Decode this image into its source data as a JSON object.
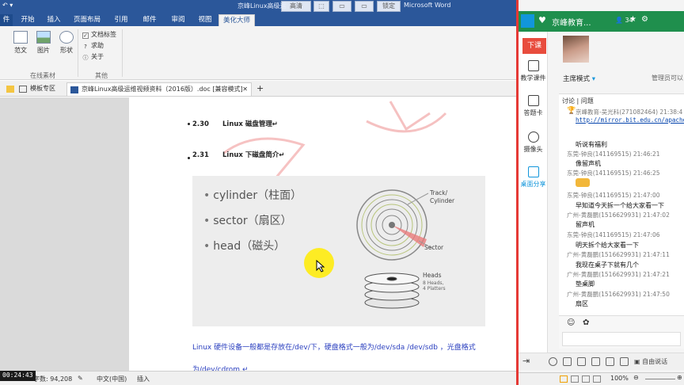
{
  "window": {
    "title": "京峰Linux高级运",
    "app_name": "Microsoft Word",
    "overlay_buttons": [
      "高清",
      "",
      "",
      "",
      "全屏",
      "",
      "锁定"
    ]
  },
  "ribbon_tabs": [
    "开始",
    "插入",
    "页面布局",
    "引用",
    "邮件",
    "审阅",
    "视图",
    "美化大师"
  ],
  "ribbon_buttons": [
    "范文",
    "图片",
    "形状"
  ],
  "ribbon_checks": [
    {
      "label": "文档标签",
      "checked": true
    },
    {
      "label": "求助",
      "checked": false
    },
    {
      "label": "关于",
      "checked": false
    }
  ],
  "ribbon_groups": [
    "在线素材",
    "其他"
  ],
  "doc_tabs": [
    {
      "label": "模板专区",
      "active": false
    },
    {
      "label": "京峰Linux高级运维视频资料（2016版）.doc [兼容模式]",
      "active": true
    }
  ],
  "doc_tabs_add": "+",
  "headings": [
    {
      "num": "2.30",
      "text": "Linux 磁盘管理↵"
    },
    {
      "num": "2.31",
      "text": "Linux 下磁盘简介↵"
    }
  ],
  "slide": {
    "items": [
      "cylinder（柱面）",
      "sector（扇区）",
      "head（磁头）"
    ],
    "disk_labels": {
      "track": "Track/",
      "cylinder": "Cylinder",
      "sector": "Sector",
      "heads": "Heads",
      "heads_sub1": "8 Heads,",
      "heads_sub2": "4 Platters"
    }
  },
  "body_text": [
    "Linux 硬件设备一般都是存放在/dev/下，硬盘格式一般为/dev/sda /dev/sdb ，光盘格式",
    "为/dev/cdrom ↵"
  ],
  "statusbar": {
    "timer": "00:24:43",
    "word_count": "字数: 94,208",
    "language": "中文(中国)",
    "mode": "插入"
  },
  "panel": {
    "title": "京峰教育...",
    "viewer_count": "34",
    "end_class": "下课",
    "side_buttons": [
      "教学课件",
      "答题卡",
      "摄像头",
      "桌面分享"
    ],
    "teaching_mode": "主席模式",
    "admin_note": "管理员可以",
    "chat_tabs": "讨论 | 问题",
    "messages": [
      {
        "head": "京峰教育-吴光科(271082464) 21:38:4",
        "body": "",
        "link": "http://mirror.bit.edu.cn/apache/to"
      },
      {
        "head": "",
        "body": "听说有福利"
      },
      {
        "head": "东莞-钟良(141169515) 21:46:21",
        "body": "像留声机"
      },
      {
        "head": "东莞-钟良(141169515) 21:46:25",
        "body": ""
      },
      {
        "head": "东莞-钟良(141169515) 21:47:00",
        "body": "早知道今天拆一个给大家看一下"
      },
      {
        "head": "广州-黄磊鹏(1516629931) 21:47:02",
        "body": "留声机"
      },
      {
        "head": "东莞-钟良(141169515) 21:47:06",
        "body": "明天拆个给大家看一下"
      },
      {
        "head": "广州-黄磊鹏(1516629931) 21:47:11",
        "body": "我现在桌子下就有几个"
      },
      {
        "head": "广州-黄磊鹏(1516629931) 21:47:21",
        "body": "垫桌脚"
      },
      {
        "head": "广州-黄磊鹏(1516629931) 21:47:50",
        "body": "扇区"
      }
    ],
    "free_talk": "自由说话",
    "zoom": "100%"
  },
  "colors": {
    "word_blue": "#2b579a",
    "panel_green": "#1f8f4d",
    "end_red": "#e84c3d",
    "body_blue": "#2a3fbf"
  }
}
